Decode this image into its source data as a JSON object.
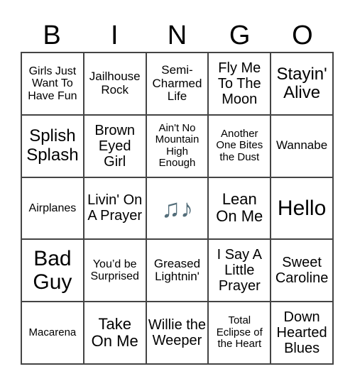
{
  "header": [
    "B",
    "I",
    "N",
    "G",
    "O"
  ],
  "cells": [
    "Girls Just Want To Have Fun",
    "Jailhouse Rock",
    "Semi-Charmed Life",
    "Fly Me To The Moon",
    "Stayin' Alive",
    "Splish Splash",
    "Brown Eyed Girl",
    "Ain't No Mountain High Enough",
    "Another One Bites the Dust",
    "Wannabe",
    "Airplanes",
    "Livin' On A Prayer",
    "music-notes-icon",
    "Lean On Me",
    "Hello",
    "Bad Guy",
    "You’d be Surprised",
    "Greased Lightnin'",
    "I Say A Little Prayer",
    "Sweet Caroline",
    "Macarena",
    "Take On Me",
    "Willie the Weeper",
    "Total Eclipse of the Heart",
    "Down Hearted Blues"
  ],
  "free_space": {
    "glyph": "♫♪",
    "color": "#546e7a"
  }
}
